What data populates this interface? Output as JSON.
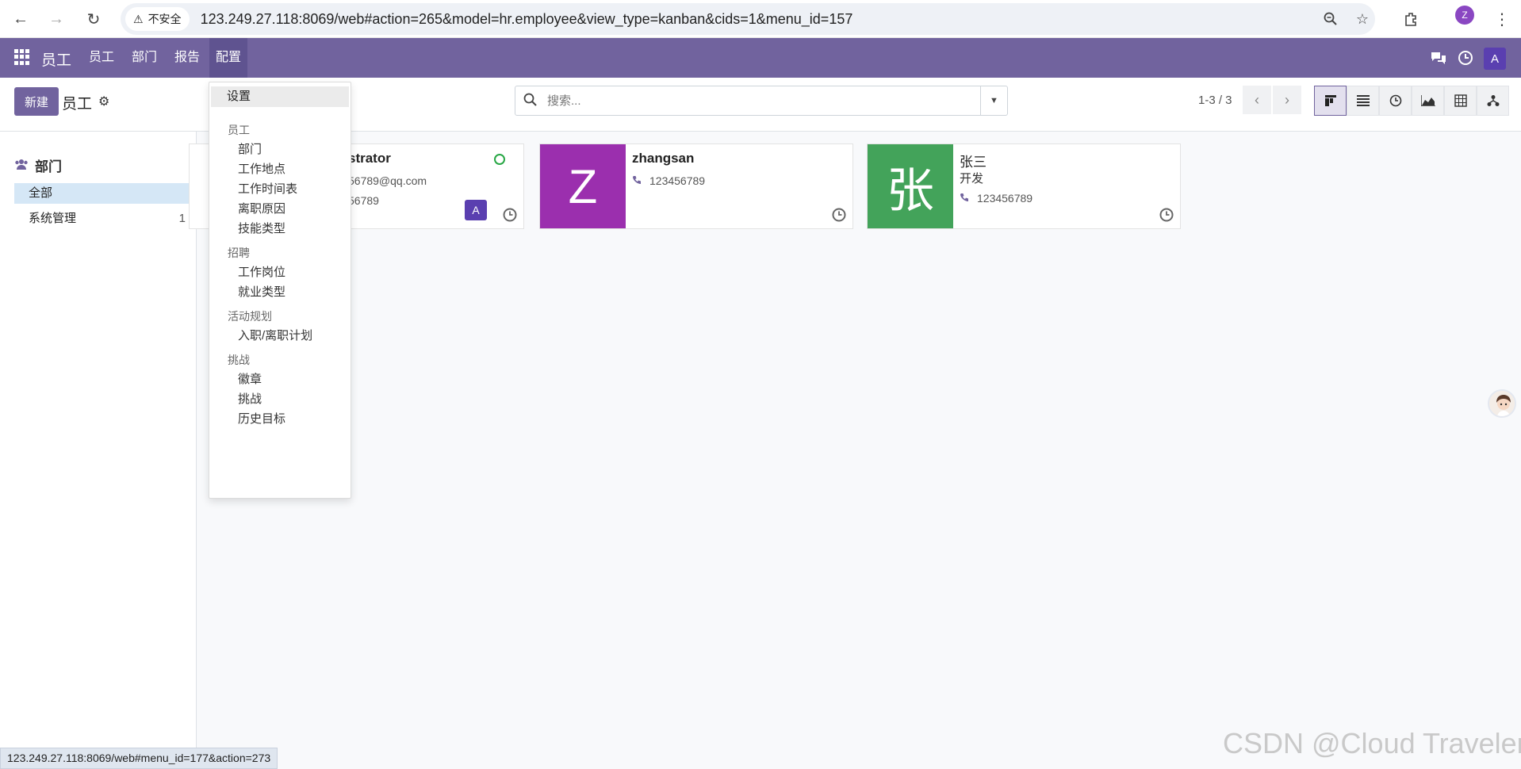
{
  "browser": {
    "insecure_label": "不安全",
    "url": "123.249.27.118:8069/web#action=265&model=hr.employee&view_type=kanban&cids=1&menu_id=157",
    "profile_initial": "Z"
  },
  "navbar": {
    "brand": "员工",
    "menu": [
      "员工",
      "部门",
      "报告",
      "配置"
    ],
    "user_initial": "A",
    "colors": {
      "bar": "#71639e",
      "active": "#5f5390"
    }
  },
  "control": {
    "new_button": "新建",
    "title": "员工",
    "search_placeholder": "搜索...",
    "pager": "1-3 / 3"
  },
  "sidebar": {
    "header": "部门",
    "items": [
      {
        "label": "全部",
        "count": ""
      },
      {
        "label": "系统管理",
        "count": "1"
      }
    ]
  },
  "dropdown": {
    "settings": "设置",
    "groups": [
      {
        "header": "员工",
        "items": [
          "部门",
          "工作地点",
          "工作时间表",
          "离职原因",
          "技能类型"
        ]
      },
      {
        "header": "招聘",
        "items": [
          "工作岗位",
          "就业类型"
        ]
      },
      {
        "header": "活动规划",
        "items": [
          "入职/离职计划"
        ]
      },
      {
        "header": "挑战",
        "items": [
          "徽章",
          "挑战",
          "历史目标"
        ]
      }
    ]
  },
  "employees": [
    {
      "name": "strator",
      "email": "56789@qq.com",
      "phone": "56789",
      "badge": "A"
    },
    {
      "name": "zhangsan",
      "phone": "123456789",
      "initial": "Z",
      "color": "#9b2fae"
    },
    {
      "name": "张三",
      "job": "开发",
      "phone": "123456789",
      "initial": "张",
      "color": "#43a35a"
    }
  ],
  "status_bar": "123.249.27.118:8069/web#menu_id=177&action=273",
  "watermark": "CSDN @Cloud Traveler"
}
